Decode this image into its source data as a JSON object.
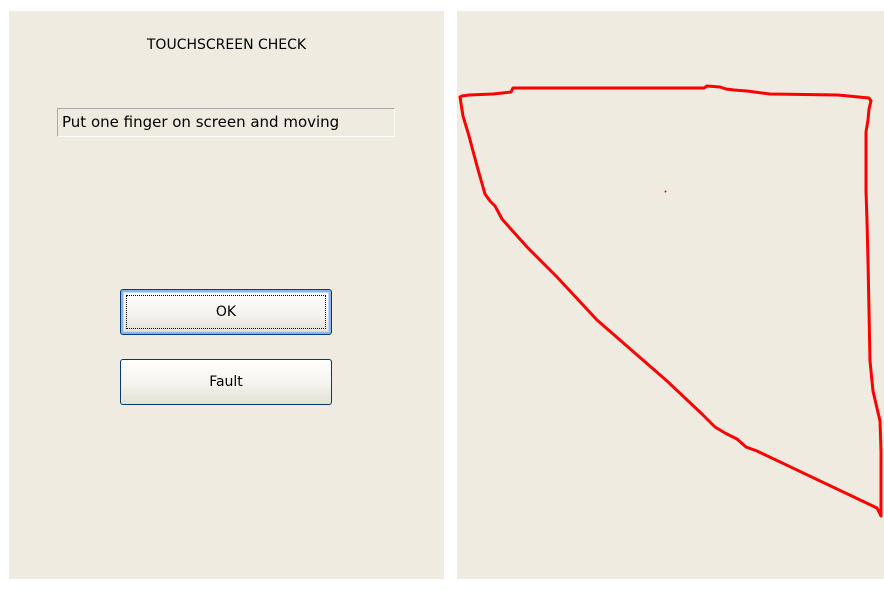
{
  "title": "TOUCHSCREEN CHECK",
  "instruction": "Put one finger on screen and moving",
  "buttons": {
    "ok_label": "OK",
    "fault_label": "Fault"
  },
  "colors": {
    "panel_background": "#efebe0",
    "trace_color": "#ff0000",
    "button_border": "#003c74"
  }
}
